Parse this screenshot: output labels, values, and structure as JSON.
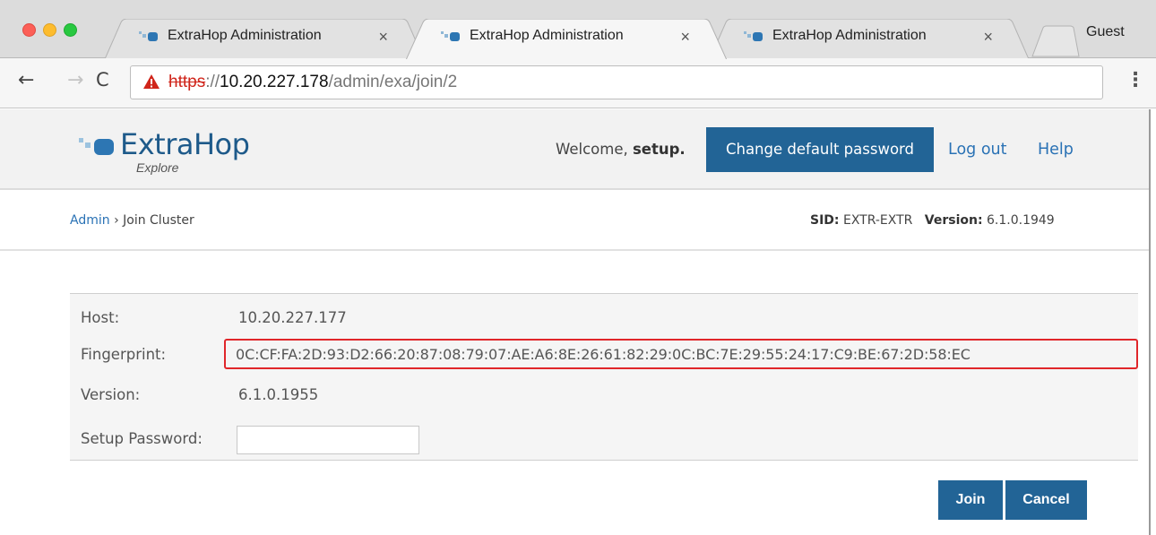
{
  "browser": {
    "tabs": [
      {
        "title": "ExtraHop Administration",
        "close": "×",
        "active": false
      },
      {
        "title": "ExtraHop Administration",
        "close": "×",
        "active": true
      },
      {
        "title": "ExtraHop Administration",
        "close": "×",
        "active": false
      }
    ],
    "profile": "Guest",
    "url": {
      "scheme": "https",
      "sep": "://",
      "host": "10.20.227.178",
      "path": "/admin/exa/join/2"
    },
    "nav": {
      "back": "←",
      "forward": "→",
      "reload": "C",
      "menu": "⋮"
    }
  },
  "header": {
    "logo": {
      "name": "ExtraHop",
      "sub": "Explore"
    },
    "welcome_prefix": "Welcome, ",
    "username": "setup.",
    "change_password": "Change default password",
    "logout": "Log out",
    "help": "Help"
  },
  "breadcrumb": {
    "root": "Admin",
    "sep": " › ",
    "current": "Join Cluster"
  },
  "system": {
    "sid_label": "SID:",
    "sid": "EXTR-EXTR",
    "version_label": "Version:",
    "version": "6.1.0.1949"
  },
  "form": {
    "host": {
      "label": "Host:",
      "value": "10.20.227.177"
    },
    "fingerprint": {
      "label": "Fingerprint:",
      "value": "0C:CF:FA:2D:93:D2:66:20:87:08:79:07:AE:A6:8E:26:61:82:29:0C:BC:7E:29:55:24:17:C9:BE:67:2D:58:EC"
    },
    "version": {
      "label": "Version:",
      "value": "6.1.0.1955"
    },
    "setup_password": {
      "label": "Setup Password:",
      "value": ""
    }
  },
  "actions": {
    "join": "Join",
    "cancel": "Cancel"
  },
  "colors": {
    "brand": "#226496",
    "link": "#2a72b5",
    "highlight": "#e0262a"
  },
  "icons": {
    "favicon": "extrahop-favicon-icon",
    "warning": "not-secure-warning-icon"
  }
}
